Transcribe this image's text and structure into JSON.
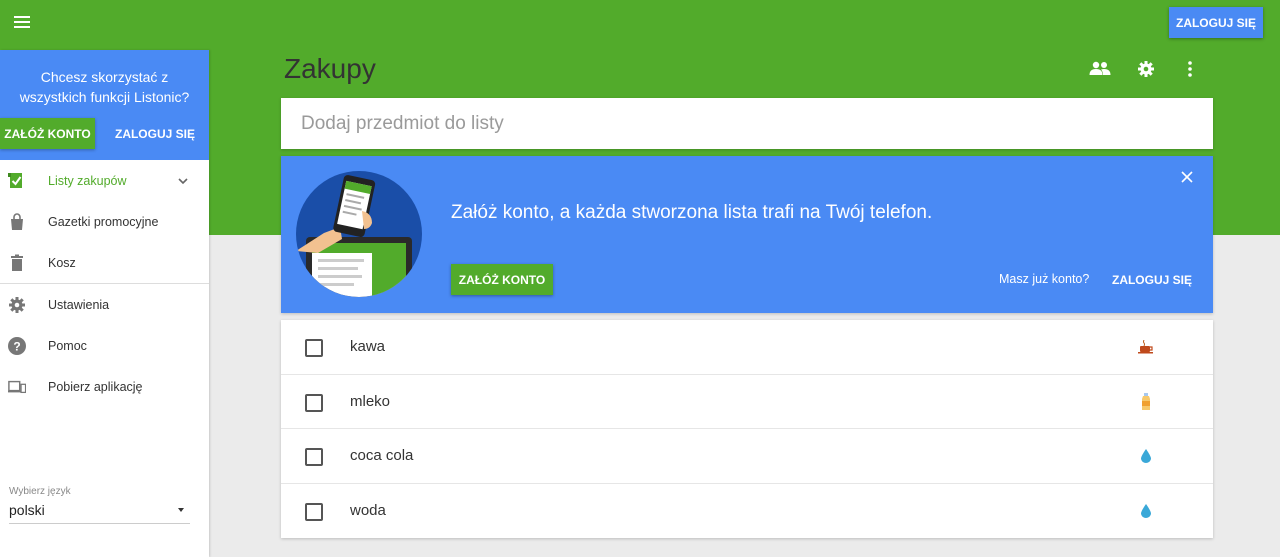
{
  "header": {
    "login_label": "ZALOGUJ SIĘ",
    "menu_icon": "hamburger-icon"
  },
  "sidebar": {
    "promo_text": "Chcesz skorzystać z wszystkich funkcji Listonic?",
    "create_account_label": "ZAŁÓŻ KONTO",
    "login_label": "ZALOGUJ SIĘ",
    "items": [
      {
        "label": "Listy zakupów",
        "icon": "shopping-list-icon",
        "active": true
      },
      {
        "label": "Gazetki promocyjne",
        "icon": "shopping-bag-icon"
      },
      {
        "label": "Kosz",
        "icon": "trash-icon"
      },
      {
        "label": "Ustawienia",
        "icon": "gear-icon"
      },
      {
        "label": "Pomoc",
        "icon": "help-icon"
      },
      {
        "label": "Pobierz aplikację",
        "icon": "devices-icon"
      }
    ],
    "language": {
      "label": "Wybierz język",
      "value": "polski"
    }
  },
  "main": {
    "title": "Zakupy",
    "add_placeholder": "Dodaj przedmiot do listy",
    "banner": {
      "message": "Załóż konto, a każda stworzona lista trafi na Twój telefon.",
      "create_label": "ZAŁÓŻ KONTO",
      "have_account": "Masz już konto?",
      "login_label": "ZALOGUJ SIĘ"
    },
    "items": [
      {
        "name": "kawa",
        "checked": false,
        "category_icon": "coffee-icon"
      },
      {
        "name": "mleko",
        "checked": false,
        "category_icon": "milk-icon"
      },
      {
        "name": "coca cola",
        "checked": false,
        "category_icon": "drop-icon"
      },
      {
        "name": "woda",
        "checked": false,
        "category_icon": "drop-icon"
      }
    ]
  },
  "colors": {
    "brand_green": "#52ab2b",
    "accent_blue": "#4a8af4",
    "background": "#ebebeb"
  }
}
